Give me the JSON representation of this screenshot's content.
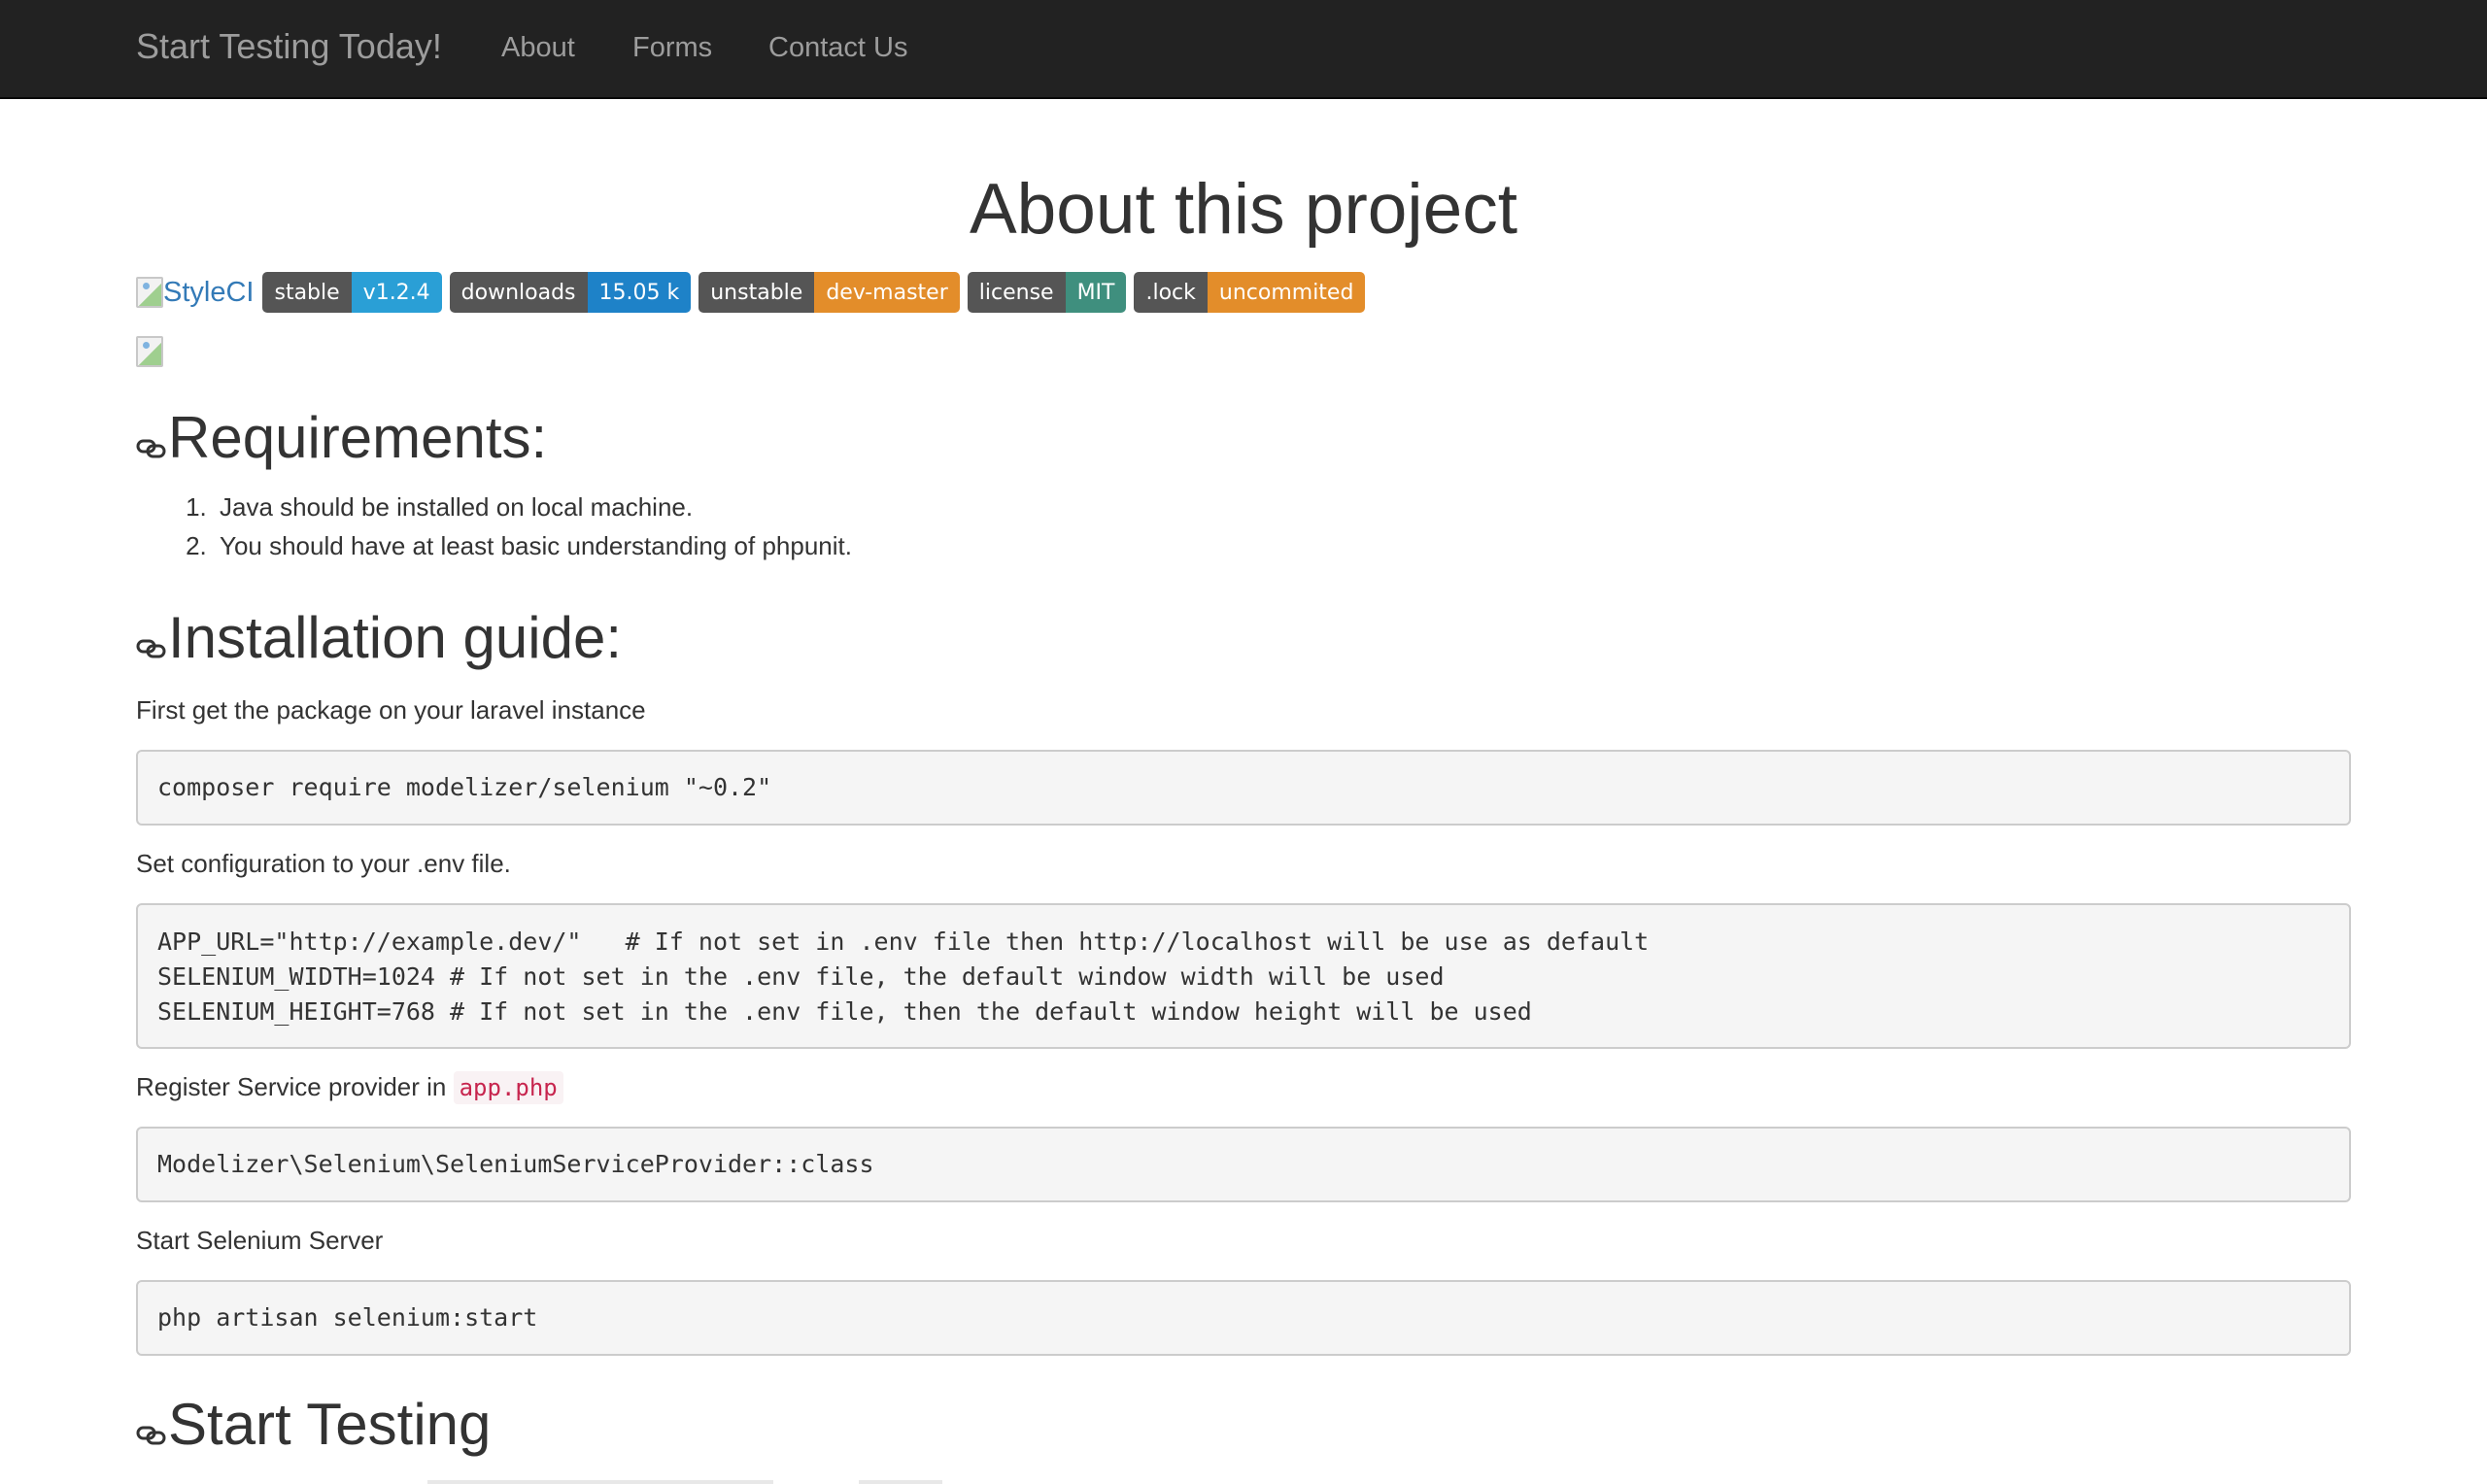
{
  "navbar": {
    "brand": "Start Testing Today!",
    "links": [
      "About",
      "Forms",
      "Contact Us"
    ]
  },
  "page": {
    "title": "About this project"
  },
  "badges": {
    "styleci_alt": "StyleCI",
    "items": [
      {
        "label": "stable",
        "value": "v1.2.4",
        "color": "#2a9fd6"
      },
      {
        "label": "downloads",
        "value": "15.05 k",
        "color": "#1e82c8"
      },
      {
        "label": "unstable",
        "value": "dev-master",
        "color": "#e38d2a"
      },
      {
        "label": "license",
        "value": "MIT",
        "color": "#3f8f7e"
      },
      {
        "label": ".lock",
        "value": "uncommited",
        "color": "#e38d2a"
      }
    ]
  },
  "requirements": {
    "heading": "Requirements:",
    "items": [
      "Java should be installed on local machine.",
      "You should have at least basic understanding of phpunit."
    ]
  },
  "installation": {
    "heading": "Installation guide:",
    "step1_text": "First get the package on your laravel instance",
    "step1_code": "composer require modelizer/selenium \"~0.2\"",
    "step2_text": "Set configuration to your .env file.",
    "step2_code": [
      "APP_URL=\"http://example.dev/\"   # If not set in .env file then http://localhost will be use as default",
      "SELENIUM_WIDTH=1024 # If not set in the .env file, the default window width will be used",
      "SELENIUM_HEIGHT=768 # If not set in the .env file, then the default window height will be used"
    ],
    "step3_text": "Register Service provider in",
    "step3_inline_code": "app.php",
    "step3_code": "Modelizer\\Selenium\\SeleniumServiceProvider::class",
    "step4_text": "Start Selenium Server",
    "step4_code": "php artisan selenium:start"
  },
  "start_testing": {
    "heading": "Start Testing"
  },
  "icons": {
    "anchor": "link-icon",
    "broken_image": "broken-image-icon"
  }
}
